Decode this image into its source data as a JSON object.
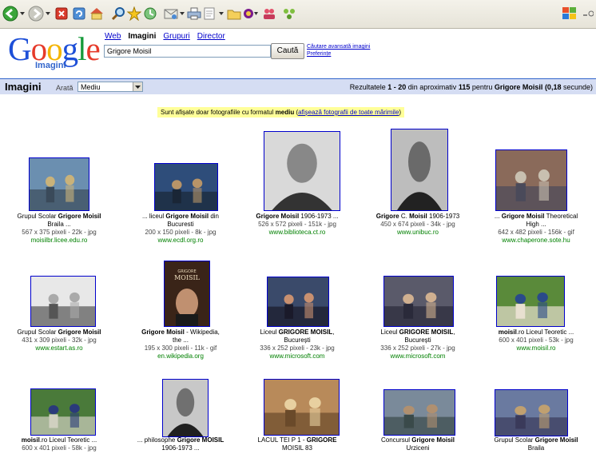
{
  "google": {
    "logo_text": "Google",
    "logo_sub": "Imagini",
    "nav": [
      {
        "label": "Web",
        "current": false
      },
      {
        "label": "Imagini",
        "current": true
      },
      {
        "label": "Grupuri",
        "current": false
      },
      {
        "label": "Director",
        "current": false
      }
    ],
    "search_value": "Grigore Moisil",
    "search_button": "Caută",
    "advanced_link": "Căutare avansată imagini",
    "prefs_link": "Preferințe"
  },
  "results_bar": {
    "title": "Imagini",
    "show_label": "Arată",
    "size_option": "Mediu",
    "summary_prefix": "Rezultatele",
    "range": "1 - 20",
    "summary_mid": "din aproximativ",
    "count": "115",
    "summary_for": "pentru",
    "query": "Grigore Moisil",
    "time": "(0,18",
    "time_unit": "secunde)"
  },
  "notice": {
    "text_prefix": "Sunt afișate doar fotografiile cu formatul",
    "format": "mediu",
    "link": "afișează fotografii de toate mărimile"
  },
  "results": [
    {
      "pre": "Grupul Scolar ",
      "bold": "Grigore Moisil",
      "post": "",
      "line2": "Braila ...",
      "meta": "567 x 375 pixeli - 22k - jpg",
      "domain": "moisilbr.licee.edu.ro"
    },
    {
      "pre": "... liceul ",
      "bold": "Grigore Moisil",
      "post": " din",
      "line2": "Bucuresti",
      "meta": "200 x 150 pixeli - 8k - jpg",
      "domain": "www.ecdl.org.ro"
    },
    {
      "pre": "",
      "bold": "Grigore Moisil",
      "post": " 1906-1973 ...",
      "line2": "",
      "meta": "526 x 572 pixeli - 151k - jpg",
      "domain": "www.biblioteca.ct.ro"
    },
    {
      "pre": "",
      "bold": "Grigore",
      "post": " C. ",
      "bold2": "Moisil",
      "post2": " 1906-1973",
      "line2": "",
      "meta": "450 x 674 pixeli - 34k - jpg",
      "domain": "www.unibuc.ro"
    },
    {
      "pre": "... ",
      "bold": "Grigore Moisil",
      "post": " Theoretical",
      "line2": "High ...",
      "meta": "642 x 482 pixeli - 156k - gif",
      "domain": "www.chaperone.sote.hu"
    },
    {
      "pre": "Grupul Scolar ",
      "bold": "Grigore Moisil",
      "post": "",
      "line2": "",
      "meta": "431 x 309 pixeli - 32k - jpg",
      "domain": "www.estart.as.ro"
    },
    {
      "pre": "",
      "bold": "Grigore Moisil",
      "post": " - Wikipedia,",
      "line2": "the ...",
      "meta": "195 x 300 pixeli - 11k - gif",
      "domain": "en.wikipedia.org"
    },
    {
      "pre": "Liceul ",
      "bold": "GRIGORE MOISIL",
      "post": ",",
      "line2": "București",
      "meta": "336 x 252 pixeli - 23k - jpg",
      "domain": "www.microsoft.com"
    },
    {
      "pre": "Liceul ",
      "bold": "GRIGORE MOISIL",
      "post": ",",
      "line2": "București",
      "meta": "336 x 252 pixeli - 27k - jpg",
      "domain": "www.microsoft.com"
    },
    {
      "pre": "",
      "bold": "moisil",
      "post": ".ro Liceul Teoretic ...",
      "line2": "",
      "meta": "600 x 401 pixeli - 53k - jpg",
      "domain": "www.moisil.ro"
    },
    {
      "pre": "",
      "bold": "moisil",
      "post": ".ro Liceul Teoretic ...",
      "line2": "",
      "meta": "600 x 401 pixeli - 58k - jpg",
      "domain": ""
    },
    {
      "pre": "... philosophe ",
      "bold": "Grigore MOISIL",
      "post": "",
      "line2": "1906-1973 ...",
      "meta": "",
      "domain": ""
    },
    {
      "pre": "LACUL TEI P 1 - ",
      "bold": "GRIGORE",
      "post": "",
      "line2": "MOISIL 83",
      "meta": "",
      "domain": ""
    },
    {
      "pre": "Concursul ",
      "bold": "Grigore Moisil",
      "post": "",
      "line2": "Urziceni",
      "meta": "",
      "domain": ""
    },
    {
      "pre": "Grupul Scolar ",
      "bold": "Grigore Moisil",
      "post": "",
      "line2": "Braila",
      "meta": "",
      "domain": ""
    }
  ],
  "book_cover": {
    "title1": "GRIGORE",
    "title2": "MOISIL"
  },
  "colors": {
    "link": "#0000cc",
    "bar": "#d5ddf3",
    "domain_green": "#008000",
    "notice_bg": "#ffff99"
  }
}
